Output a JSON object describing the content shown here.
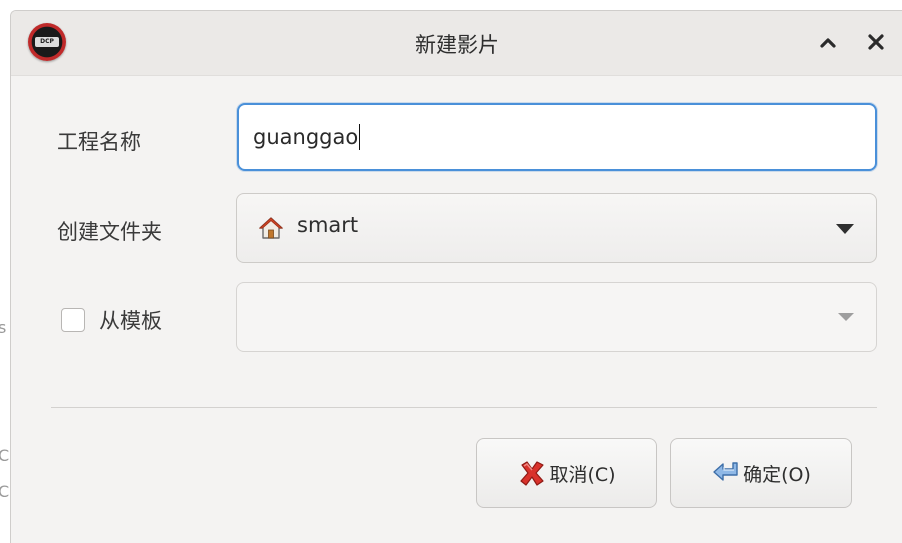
{
  "window": {
    "title": "新建影片",
    "app_icon_text": "DCP"
  },
  "form": {
    "project_name_label": "工程名称",
    "project_name_value": "guanggao",
    "folder_label": "创建文件夹",
    "folder_value": "smart",
    "template_label": "从模板",
    "template_checked": false,
    "template_value": ""
  },
  "buttons": {
    "cancel_label": "取消(C)",
    "ok_label": "确定(O)"
  },
  "icons": {
    "app": "dcp-o-matic-icon",
    "collapse": "chevron-up-icon",
    "close": "close-icon",
    "folder": "home-icon",
    "cancel": "red-x-icon",
    "ok": "return-arrow-icon"
  },
  "colors": {
    "focus_border": "#4a90d9",
    "dialog_bg": "#f4f3f2",
    "titlebar_bg": "#ebe9e7"
  }
}
